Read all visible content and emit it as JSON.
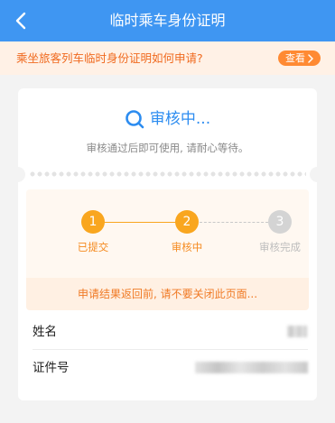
{
  "header": {
    "title": "临时乘车身份证明"
  },
  "notice": {
    "text": "乘坐旅客列车临时身份证明如何申请?",
    "button_label": "查看"
  },
  "status": {
    "title": "审核中...",
    "subtitle": "审核通过后即可使用, 请耐心等待。"
  },
  "steps": [
    {
      "number": "1",
      "label": "已提交",
      "state": "done"
    },
    {
      "number": "2",
      "label": "审核中",
      "state": "current"
    },
    {
      "number": "3",
      "label": "审核完成",
      "state": "pending"
    }
  ],
  "warning": "申请结果返回前, 请不要关闭此页面...",
  "info": {
    "name_label": "姓名",
    "id_label": "证件号"
  },
  "colors": {
    "header": "#3f96f2",
    "accent_orange": "#f9a61f",
    "notice_text": "#f06a1f",
    "status_blue": "#2c8cf0"
  }
}
